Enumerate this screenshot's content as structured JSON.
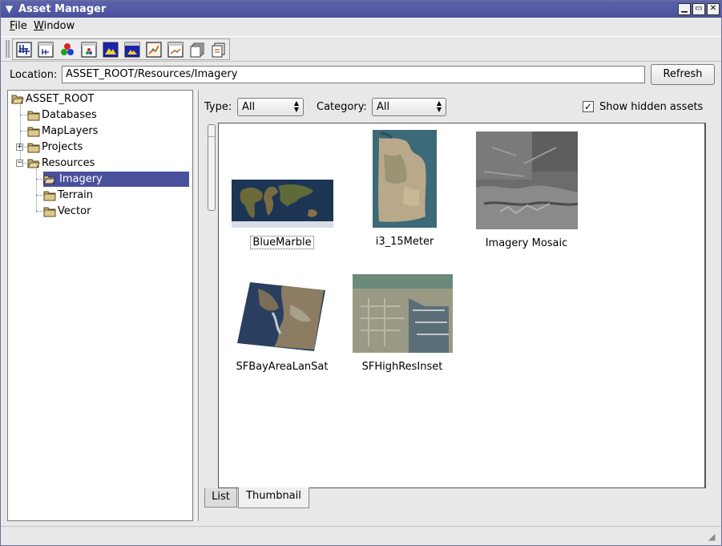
{
  "window": {
    "title": "Asset Manager",
    "accent": "#4a519c"
  },
  "menubar": {
    "file_key": "F",
    "file_rest": "ile",
    "window_key": "W",
    "window_rest": "indow"
  },
  "toolbar": {
    "tools": [
      "new-database-icon",
      "new-map-layer-icon",
      "new-image-resource-icon",
      "new-imagery-project-icon",
      "new-terrain-resource-icon",
      "new-terrain-project-icon",
      "new-vector-resource-icon",
      "new-vector-project-icon",
      "open-folder-icon",
      "open-project-icon"
    ]
  },
  "location": {
    "label": "Location:",
    "value": "ASSET_ROOT/Resources/Imagery",
    "refresh_label": "Refresh"
  },
  "tree": {
    "root": "ASSET_ROOT",
    "items": [
      {
        "label": "Databases"
      },
      {
        "label": "MapLayers"
      },
      {
        "label": "Projects"
      },
      {
        "label": "Resources"
      }
    ],
    "resources_children": [
      {
        "label": "Imagery"
      },
      {
        "label": "Terrain"
      },
      {
        "label": "Vector"
      }
    ]
  },
  "filters": {
    "type_label": "Type:",
    "type_value": "All",
    "category_label": "Category:",
    "category_value": "All",
    "show_hidden_label": "Show hidden assets",
    "show_hidden_checked": "✓"
  },
  "assets": [
    {
      "name": "BlueMarble"
    },
    {
      "name": "i3_15Meter"
    },
    {
      "name": "Imagery Mosaic"
    },
    {
      "name": "SFBayAreaLanSat"
    },
    {
      "name": "SFHighResInset"
    }
  ],
  "tabs": {
    "list": "List",
    "thumbnail": "Thumbnail"
  }
}
